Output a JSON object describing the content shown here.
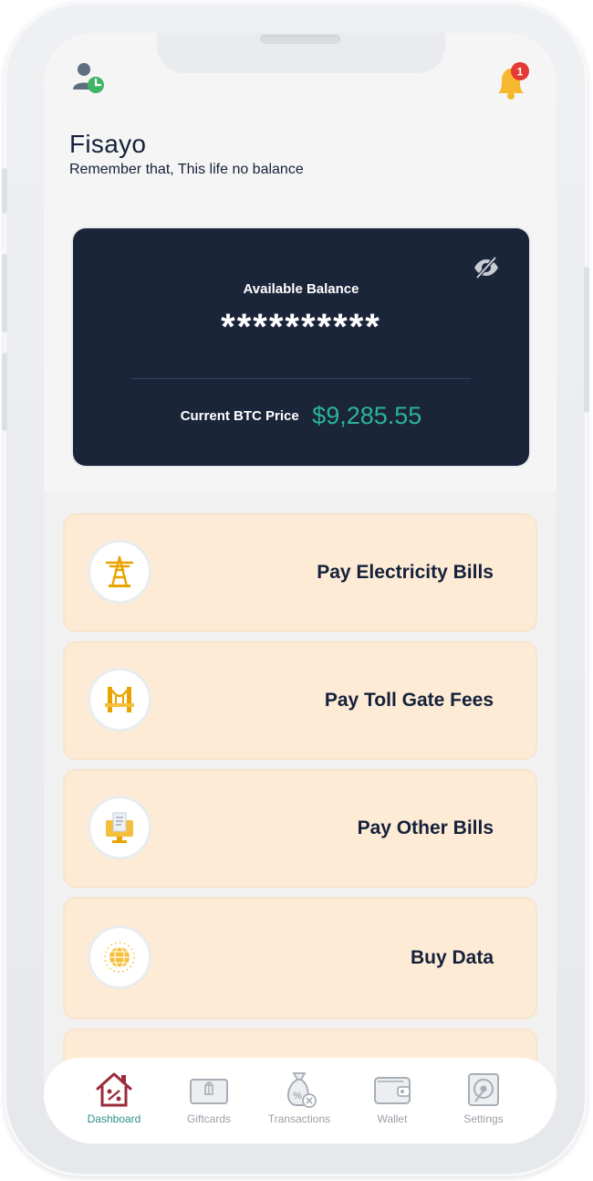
{
  "header": {
    "user_name": "Fisayo",
    "tagline": "Remember that, This life no balance",
    "notification_count": "1"
  },
  "balance_card": {
    "label": "Available Balance",
    "masked_value": "**********",
    "btc_label": "Current BTC Price",
    "btc_price": "$9,285.55"
  },
  "services": [
    {
      "label": "Pay Electricity Bills",
      "icon": "electricity-tower-icon"
    },
    {
      "label": "Pay Toll Gate Fees",
      "icon": "bridge-icon"
    },
    {
      "label": "Pay Other Bills",
      "icon": "monitor-bill-icon"
    },
    {
      "label": "Buy Data",
      "icon": "globe-icon"
    }
  ],
  "tabs": [
    {
      "label": "Dashboard",
      "icon": "house-percent-icon",
      "active": true
    },
    {
      "label": "Giftcards",
      "icon": "giftcard-icon",
      "active": false
    },
    {
      "label": "Transactions",
      "icon": "money-bag-icon",
      "active": false
    },
    {
      "label": "Wallet",
      "icon": "wallet-icon",
      "active": false
    },
    {
      "label": "Settings",
      "icon": "settings-disk-icon",
      "active": false
    }
  ],
  "colors": {
    "card_bg": "#1b253a",
    "accent_green": "#2bb39a",
    "service_bg": "#fdebd6",
    "bell": "#f5b82e",
    "badge": "#e53935",
    "active_tab": "#2a8f8a",
    "dashboard_icon": "#9c2b3c"
  }
}
